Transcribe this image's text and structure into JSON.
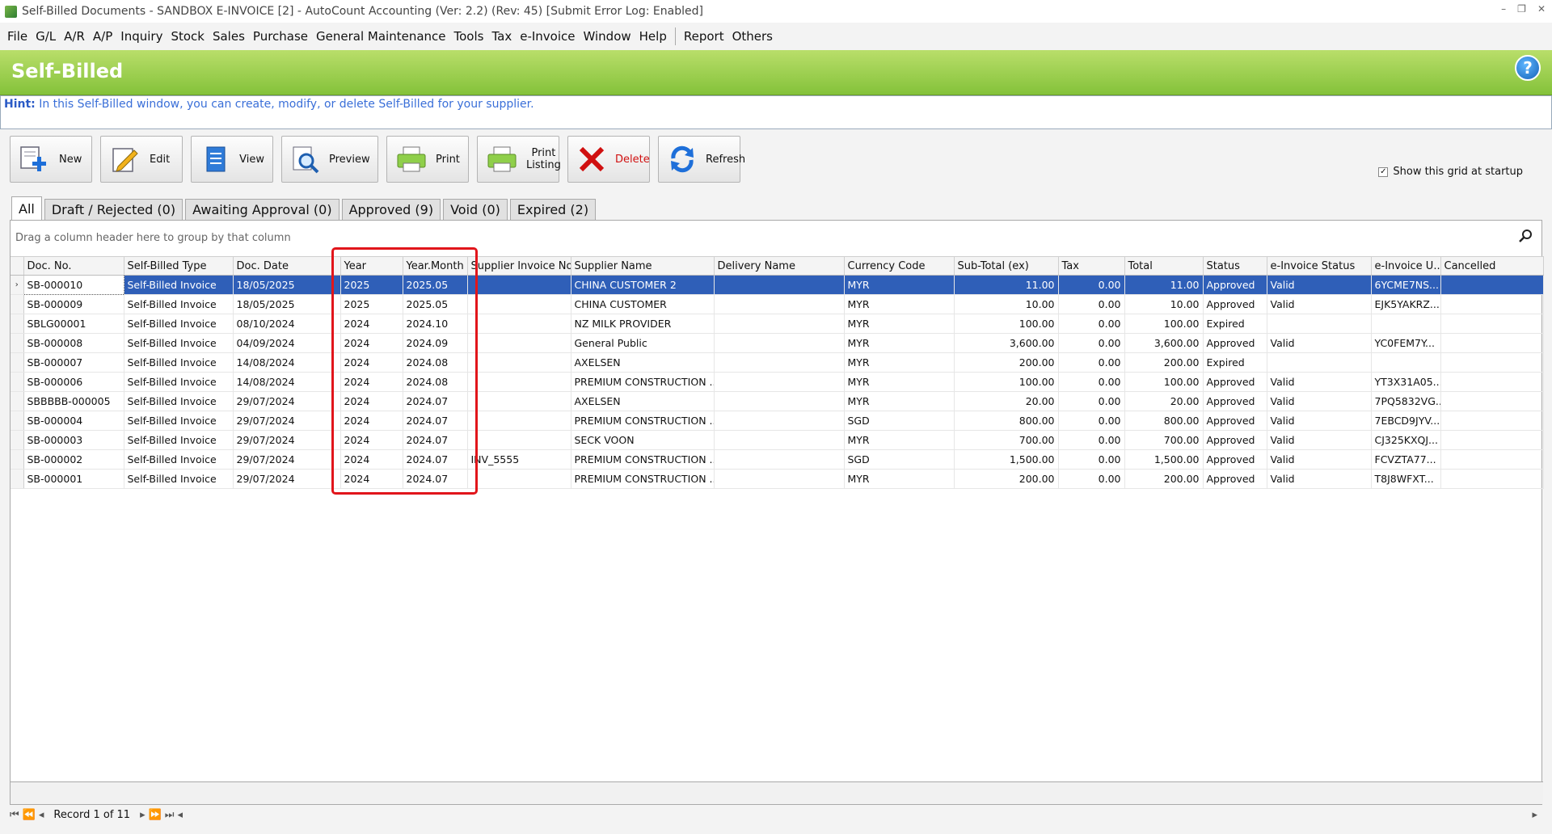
{
  "window": {
    "title": "Self-Billed Documents - SANDBOX E-INVOICE [2] - AutoCount Accounting (Ver: 2.2) (Rev: 45) [Submit Error Log: Enabled]"
  },
  "menu": [
    "File",
    "G/L",
    "A/R",
    "A/P",
    "Inquiry",
    "Stock",
    "Sales",
    "Purchase",
    "General Maintenance",
    "Tools",
    "Tax",
    "e-Invoice",
    "Window",
    "Help",
    "Report",
    "Others"
  ],
  "banner": {
    "title": "Self-Billed",
    "help": "?"
  },
  "hint": {
    "label": "Hint:",
    "text": " In this Self-Billed window, you can create, modify, or delete Self-Billed for your supplier."
  },
  "toolbar": {
    "new": "New",
    "edit": "Edit",
    "view": "View",
    "preview": "Preview",
    "print": "Print",
    "print_listing_1": "Print",
    "print_listing_2": "Listing",
    "delete": "Delete",
    "refresh": "Refresh"
  },
  "show_grid": {
    "label": "Show this grid at startup",
    "checked": true,
    "mark": "✓"
  },
  "tabs": [
    "All",
    "Draft / Rejected (0)",
    "Awaiting Approval (0)",
    "Approved (9)",
    "Void (0)",
    "Expired (2)"
  ],
  "grid": {
    "group_hint": "Drag a column header here to group by that column",
    "columns": [
      "Doc. No.",
      "Self-Billed Type",
      "Doc. Date",
      "Year",
      "Year.Month",
      "Supplier Invoice No.",
      "Supplier Name",
      "Delivery Name",
      "Currency Code",
      "Sub-Total (ex)",
      "Tax",
      "Total",
      "Status",
      "e-Invoice Status",
      "e-Invoice U...",
      "Cancelled"
    ],
    "rows": [
      [
        "SB-000010",
        "Self-Billed Invoice",
        "18/05/2025",
        "2025",
        "2025.05",
        "",
        "CHINA CUSTOMER 2",
        "",
        "MYR",
        "11.00",
        "0.00",
        "11.00",
        "Approved",
        "Valid",
        "6YCME7NS...",
        ""
      ],
      [
        "SB-000009",
        "Self-Billed Invoice",
        "18/05/2025",
        "2025",
        "2025.05",
        "",
        "CHINA CUSTOMER",
        "",
        "MYR",
        "10.00",
        "0.00",
        "10.00",
        "Approved",
        "Valid",
        "EJK5YAKRZ...",
        ""
      ],
      [
        "SBLG00001",
        "Self-Billed Invoice",
        "08/10/2024",
        "2024",
        "2024.10",
        "",
        "NZ MILK PROVIDER",
        "",
        "MYR",
        "100.00",
        "0.00",
        "100.00",
        "Expired",
        "",
        "",
        ""
      ],
      [
        "SB-000008",
        "Self-Billed Invoice",
        "04/09/2024",
        "2024",
        "2024.09",
        "",
        "General Public",
        "",
        "MYR",
        "3,600.00",
        "0.00",
        "3,600.00",
        "Approved",
        "Valid",
        "YC0FEM7Y...",
        ""
      ],
      [
        "SB-000007",
        "Self-Billed Invoice",
        "14/08/2024",
        "2024",
        "2024.08",
        "",
        "AXELSEN",
        "",
        "MYR",
        "200.00",
        "0.00",
        "200.00",
        "Expired",
        "",
        "",
        ""
      ],
      [
        "SB-000006",
        "Self-Billed Invoice",
        "14/08/2024",
        "2024",
        "2024.08",
        "",
        "PREMIUM CONSTRUCTION ...",
        "",
        "MYR",
        "100.00",
        "0.00",
        "100.00",
        "Approved",
        "Valid",
        "YT3X31A05...",
        ""
      ],
      [
        "SBBBBB-000005",
        "Self-Billed Invoice",
        "29/07/2024",
        "2024",
        "2024.07",
        "",
        "AXELSEN",
        "",
        "MYR",
        "20.00",
        "0.00",
        "20.00",
        "Approved",
        "Valid",
        "7PQ5832VG...",
        ""
      ],
      [
        "SB-000004",
        "Self-Billed Invoice",
        "29/07/2024",
        "2024",
        "2024.07",
        "",
        "PREMIUM CONSTRUCTION ...",
        "",
        "SGD",
        "800.00",
        "0.00",
        "800.00",
        "Approved",
        "Valid",
        "7EBCD9JYV...",
        ""
      ],
      [
        "SB-000003",
        "Self-Billed Invoice",
        "29/07/2024",
        "2024",
        "2024.07",
        "",
        "SECK VOON",
        "",
        "MYR",
        "700.00",
        "0.00",
        "700.00",
        "Approved",
        "Valid",
        "CJ325KXQJ...",
        ""
      ],
      [
        "SB-000002",
        "Self-Billed Invoice",
        "29/07/2024",
        "2024",
        "2024.07",
        "INV_5555",
        "PREMIUM CONSTRUCTION ...",
        "",
        "SGD",
        "1,500.00",
        "0.00",
        "1,500.00",
        "Approved",
        "Valid",
        "FCVZTA77...",
        ""
      ],
      [
        "SB-000001",
        "Self-Billed Invoice",
        "29/07/2024",
        "2024",
        "2024.07",
        "",
        "PREMIUM CONSTRUCTION ...",
        "",
        "MYR",
        "200.00",
        "0.00",
        "200.00",
        "Approved",
        "Valid",
        "T8J8WFXT...",
        ""
      ]
    ],
    "selected_row": 0,
    "row_indicator": "›"
  },
  "navigator": {
    "record_text": "Record 1 of 11"
  },
  "colors": {
    "banner": "#8cc63f",
    "selection": "#2f5fb8",
    "highlight": "#e1151b"
  }
}
